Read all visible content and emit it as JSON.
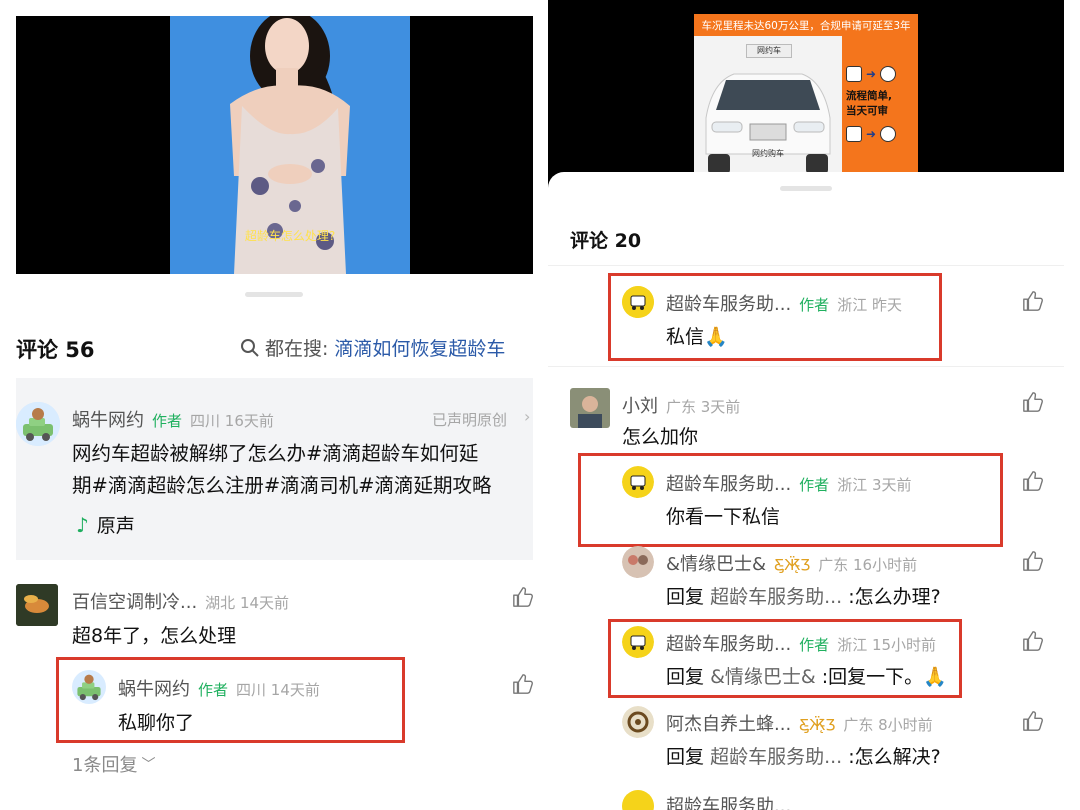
{
  "left": {
    "video": {
      "caption": "超龄车怎么处理?"
    },
    "comments_header": {
      "title": "评论 56",
      "search_prefix": "都在搜:",
      "search_query": "滴滴如何恢复超龄车"
    },
    "pinned": {
      "username": "蜗牛网约",
      "author_tag": "作者",
      "meta": "四川 16天前",
      "declaration": "已声明原创",
      "text_line1": "网约车超龄被解绑了怎么办#滴滴超龄车如何延",
      "text_line2": "期#滴滴超龄怎么注册#滴滴司机#滴滴延期攻略",
      "sound": "原声"
    },
    "comment1": {
      "username": "百信空调制冷...",
      "meta": "湖北 14天前",
      "text": "超8年了，怎么处理"
    },
    "reply1": {
      "username": "蜗牛网约",
      "author_tag": "作者",
      "meta": "四川 14天前",
      "text": "私聊你了"
    },
    "more_replies": "1条回复"
  },
  "right": {
    "banner": {
      "headline": "车况里程未达60万公里，合规申请可延至3年",
      "plate_top": "网约车",
      "plate_bottom": "网约购车",
      "step_text1": "流程简单,",
      "step_text2": "当天可审"
    },
    "comments_header": {
      "title": "评论 20"
    },
    "c1": {
      "username": "超龄车服务助...",
      "author_tag": "作者",
      "meta": "浙江 昨天",
      "text": "私信🙏"
    },
    "c2": {
      "username": "小刘",
      "meta": "广东 3天前",
      "text": "怎么加你"
    },
    "c3": {
      "username": "超龄车服务助...",
      "author_tag": "作者",
      "meta": "浙江 3天前",
      "text": "你看一下私信"
    },
    "c4": {
      "username": "&情缘巴士&",
      "meta": "广东 16小时前",
      "reply_word": "回复",
      "reply_to": "超龄车服务助...",
      "text": ":怎么办理?"
    },
    "c5": {
      "username": "超龄车服务助...",
      "author_tag": "作者",
      "meta": "浙江 15小时前",
      "reply_word": "回复",
      "reply_to": "&情缘巴士&",
      "text": ":回复一下。🙏"
    },
    "c6": {
      "username": "阿杰自养土蜂...",
      "meta": "广东 8小时前",
      "reply_word": "回复",
      "reply_to": "超龄车服务助...",
      "text": ":怎么解决?"
    },
    "c7": {
      "username": "超龄车服务助..."
    }
  },
  "colors": {
    "highlight_red": "#d93a2b",
    "author_green": "#20b05f",
    "link_blue": "#2b5aa8",
    "banner_orange": "#f4751c"
  }
}
